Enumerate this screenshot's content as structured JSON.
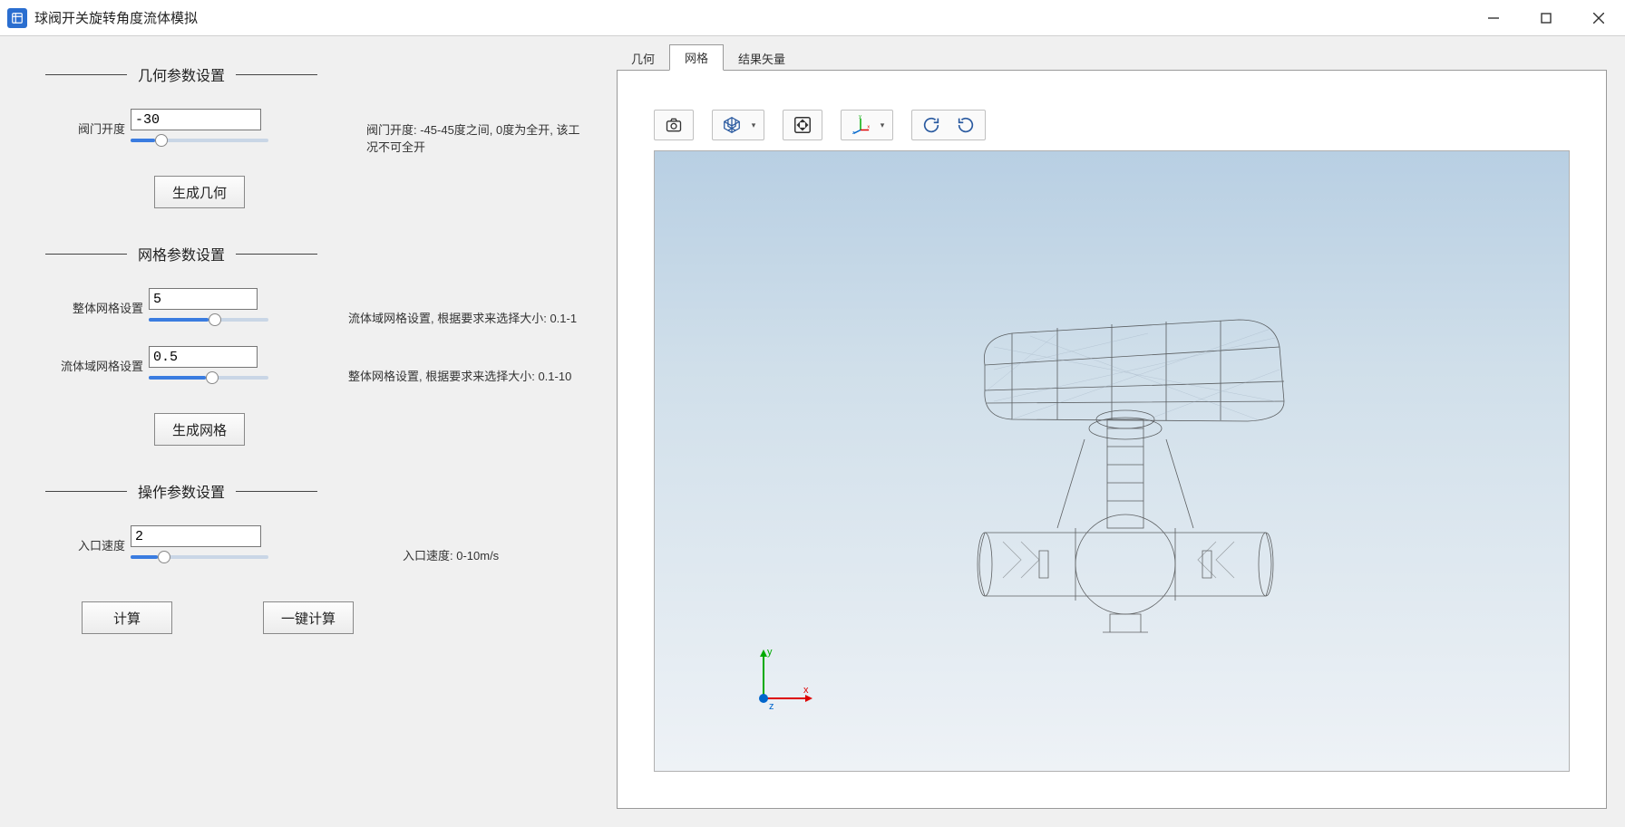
{
  "window": {
    "title": "球阀开关旋转角度流体模拟"
  },
  "sections": {
    "geometry_title": "几何参数设置",
    "mesh_title": "网格参数设置",
    "operation_title": "操作参数设置"
  },
  "params": {
    "valve_angle_label": "阀门开度",
    "valve_angle_value": "-30",
    "valve_angle_hint": "阀门开度: -45-45度之间, 0度为全开, 该工况不可全开",
    "global_mesh_label": "整体网格设置",
    "global_mesh_value": "5",
    "fluid_mesh_label": "流体域网格设置",
    "fluid_mesh_value": "0.5",
    "fluid_mesh_hint": "流体域网格设置, 根据要求来选择大小: 0.1-1",
    "global_mesh_hint": "整体网格设置, 根据要求来选择大小: 0.1-10",
    "inlet_v_label": "入口速度",
    "inlet_v_value": "2",
    "inlet_v_hint": "入口速度: 0-10m/s"
  },
  "buttons": {
    "gen_geometry": "生成几何",
    "gen_mesh": "生成网格",
    "compute": "计算",
    "compute_oneclick": "一键计算"
  },
  "tabs": {
    "geometry": "几何",
    "mesh": "网格",
    "result": "结果矢量"
  },
  "triad": {
    "x": "x",
    "y": "y",
    "z": "z"
  }
}
